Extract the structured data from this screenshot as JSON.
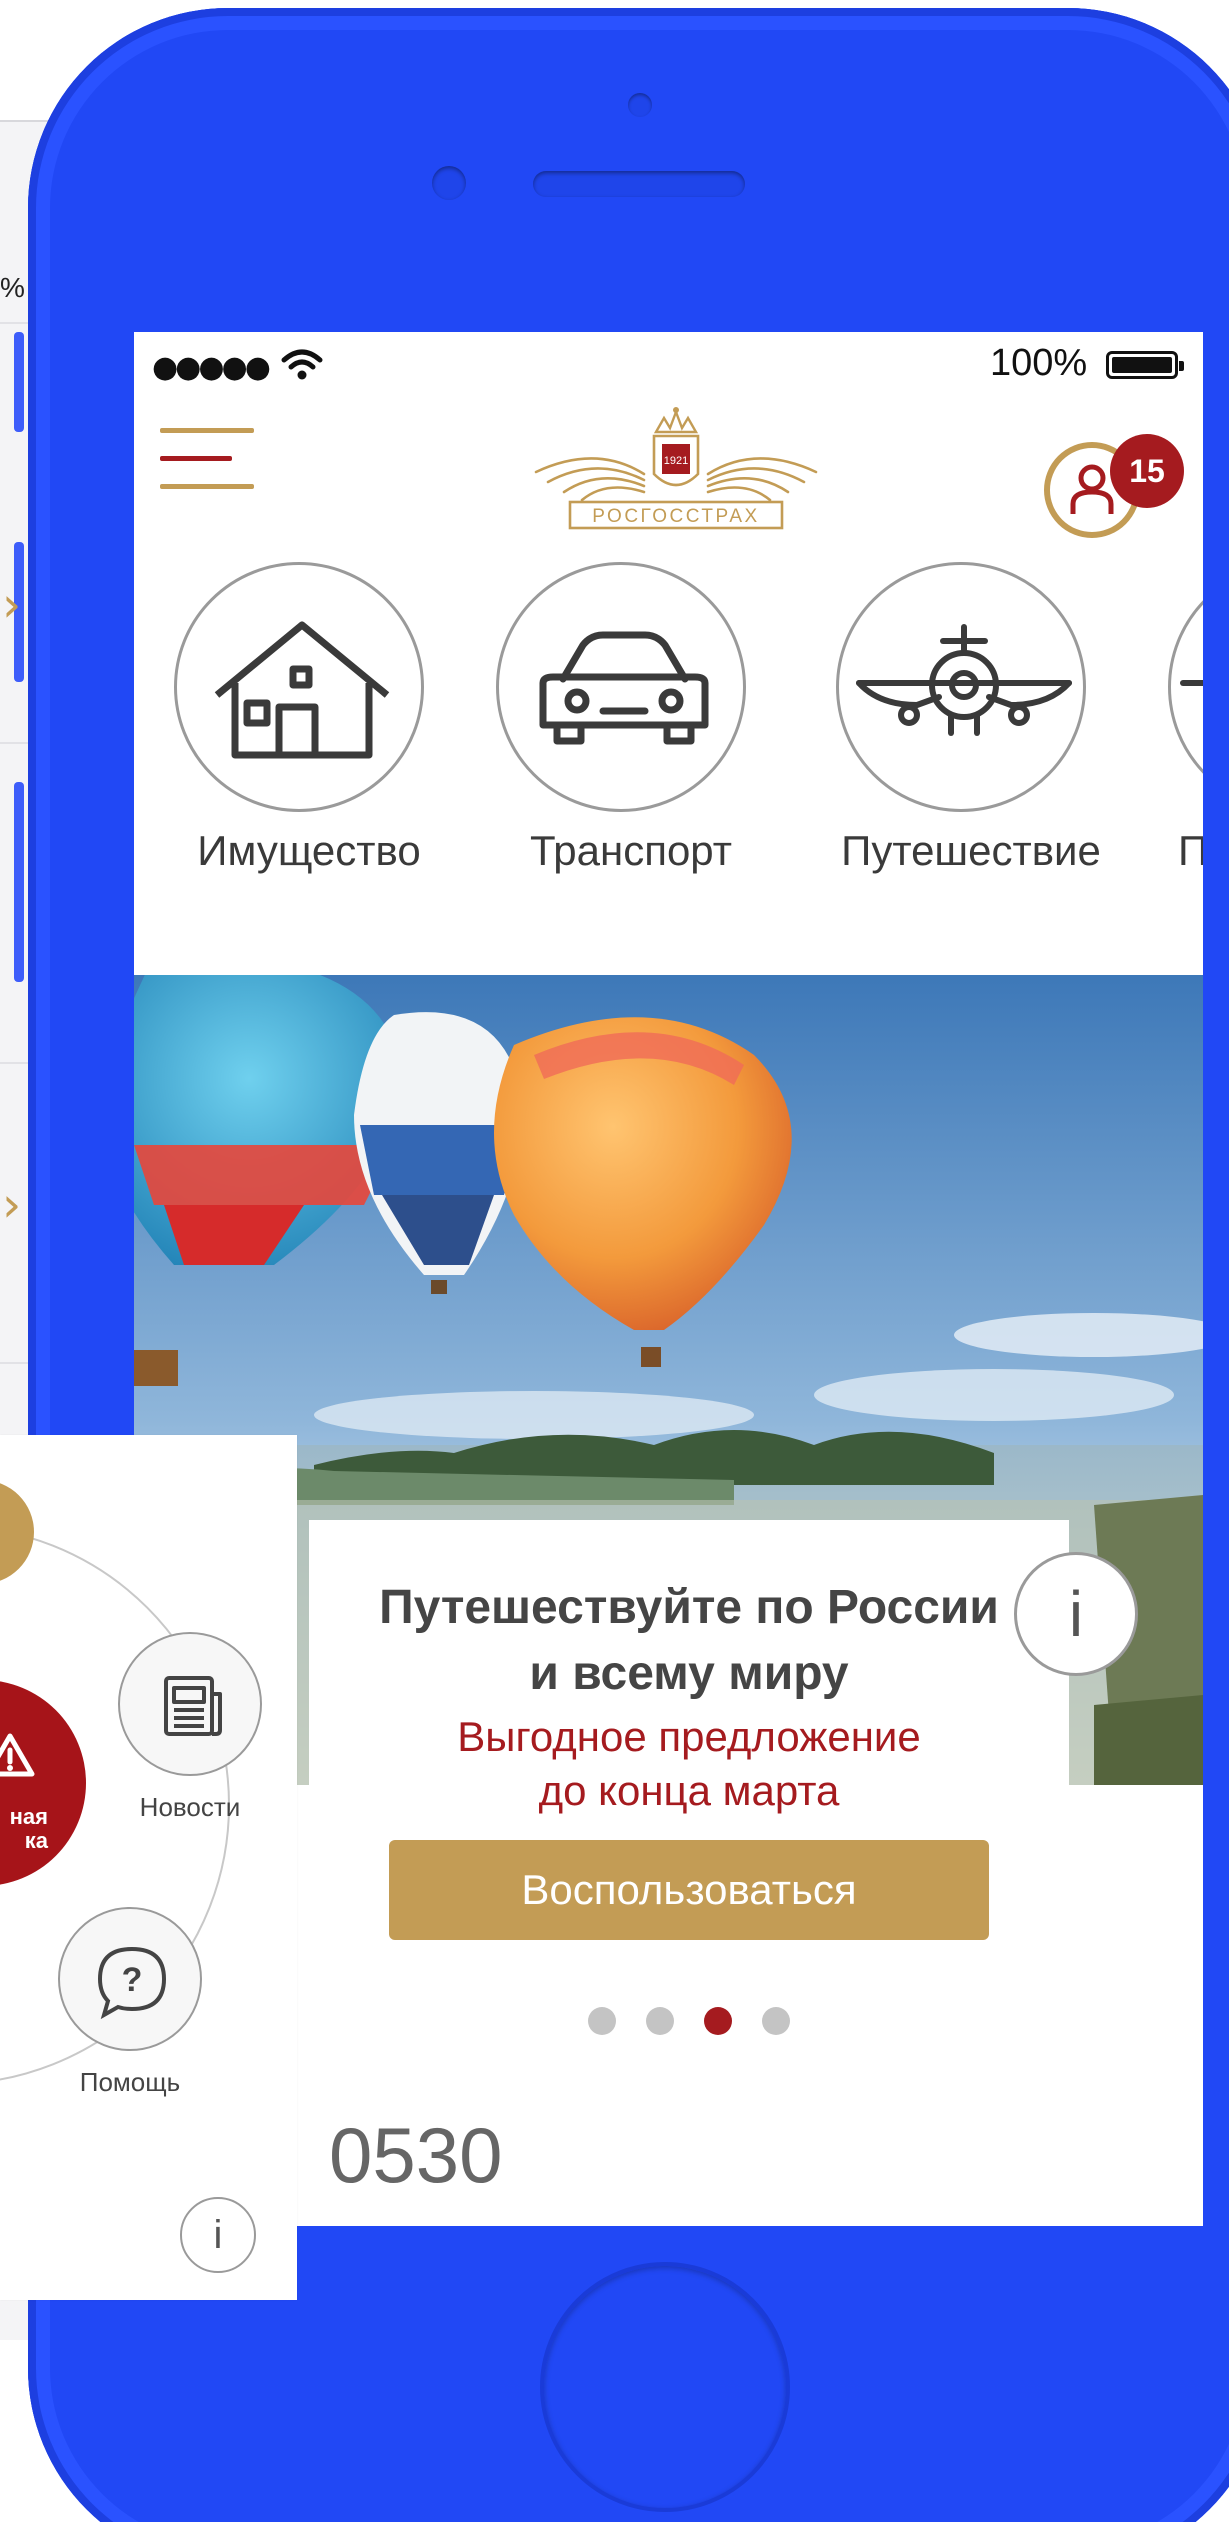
{
  "background_screen": {
    "partial_text": "% I"
  },
  "status_bar": {
    "signal": "●●●●●",
    "battery_percent": "100%",
    "battery_level": 1.0
  },
  "header": {
    "logo_year": "1921",
    "logo_text": "РОСГОССТРАХ",
    "notification_count": "15"
  },
  "categories": [
    {
      "label": "Имущество",
      "icon": "house-icon"
    },
    {
      "label": "Транспорт",
      "icon": "car-icon"
    },
    {
      "label": "Путешествие",
      "icon": "airplane-icon"
    },
    {
      "label": "Пу",
      "icon": "partial-icon"
    }
  ],
  "promo": {
    "title_line1": "Путешествуйте по России",
    "title_line2": "и всему миру",
    "subtitle_line1": "Выгодное предложение",
    "subtitle_line2": "до конца марта",
    "button_label": "Воспользоваться",
    "carousel_page_count": 4,
    "carousel_active_index": 3
  },
  "contact": {
    "phone_partial": "0530",
    "info_glyph": "i"
  },
  "overlay_menu": {
    "emergency_label_line1": "ная",
    "emergency_label_line2": "ка",
    "news_label": "Новости",
    "help_label": "Помощь",
    "info_glyph": "i"
  },
  "colors": {
    "brand_red": "#a51b1f",
    "brand_gold": "#c39c55",
    "phone_body": "#2148f5"
  }
}
